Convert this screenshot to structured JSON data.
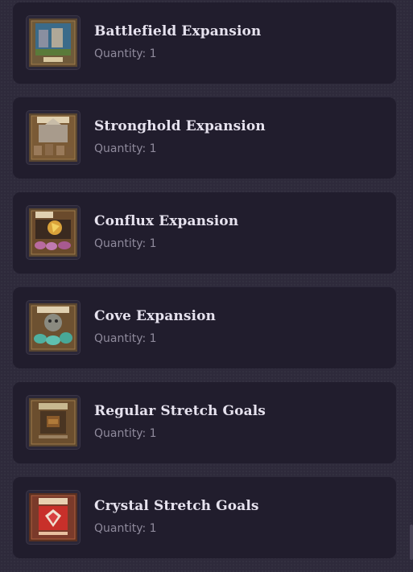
{
  "items": [
    {
      "title": "Battlefield Expansion",
      "quantity": "Quantity: 1",
      "icon": "battlefield-box-art-icon",
      "accent": "#6f5a3a",
      "art": "#3b6b8a"
    },
    {
      "title": "Stronghold Expansion",
      "quantity": "Quantity: 1",
      "icon": "stronghold-box-art-icon",
      "accent": "#7a5a36",
      "art": "#a89b8c"
    },
    {
      "title": "Conflux Expansion",
      "quantity": "Quantity: 1",
      "icon": "conflux-box-art-icon",
      "accent": "#6a4a2c",
      "art": "#d9a23a"
    },
    {
      "title": "Cove Expansion",
      "quantity": "Quantity: 1",
      "icon": "cove-box-art-icon",
      "accent": "#6d5131",
      "art": "#4fb0a0"
    },
    {
      "title": "Regular Stretch Goals",
      "quantity": "Quantity: 1",
      "icon": "regular-stretch-goals-box-art-icon",
      "accent": "#6b4e2e",
      "art": "#8a5a2a"
    },
    {
      "title": "Crystal Stretch Goals",
      "quantity": "Quantity: 1",
      "icon": "crystal-stretch-goals-box-art-icon",
      "accent": "#7a3a2a",
      "art": "#c8302a"
    }
  ]
}
